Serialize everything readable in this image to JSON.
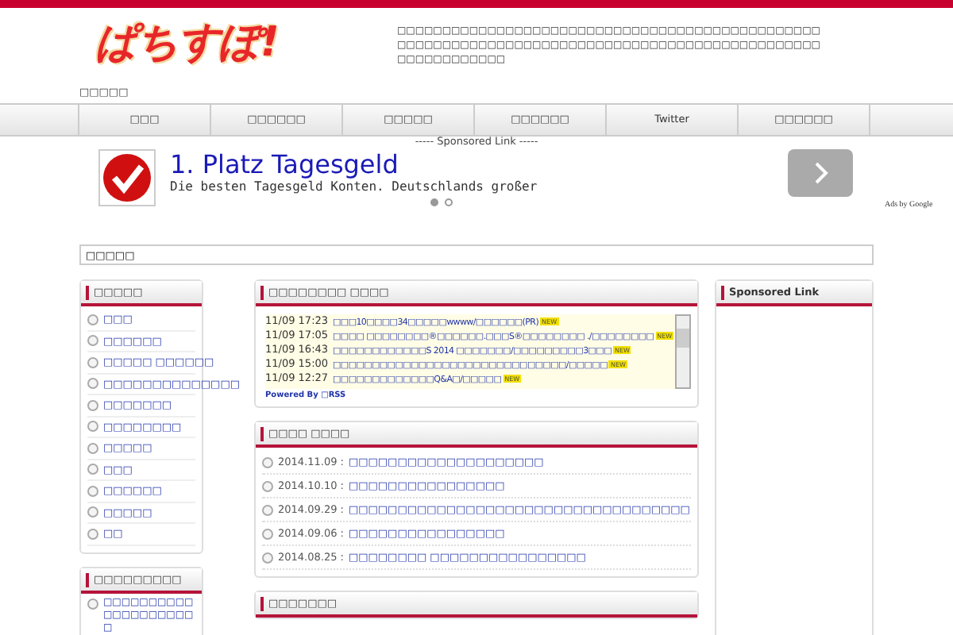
{
  "header": {
    "logo": "ぱちすぽ!",
    "description": "□□□□□□□□□□□□□□□□□□□□□□□□□□□□□□□□□□□□□□□□□□□□□□□□□□□□□□□□□□□□□□□□□□□□□□□□□□□□□□□□□□□□□□□□□□□□□□□□□□□□□□□□□□",
    "breadcrumb": "□□□□□"
  },
  "nav": [
    "□□□",
    "□□□□□□",
    "□□□□□",
    "□□□□□□",
    "Twitter",
    "□□□□□□"
  ],
  "ad": {
    "label": "----- Sponsored Link -----",
    "title": "1. Platz Tagesgeld",
    "text": "Die besten Tagesgeld Konten. Deutschlands großer",
    "pages": [
      {
        "selected": true
      },
      {
        "selected": false
      }
    ],
    "ads_by": "Ads by Google"
  },
  "search": {
    "value": "□□□□□"
  },
  "left": {
    "title": "□□□□□",
    "items": [
      "□□□",
      "□□□□□□",
      "□□□□□ □□□□□□",
      "□□□□□□□□□□□□□□",
      "□□□□□□□",
      "□□□□□□□□",
      "□□□□□",
      "□□□",
      "□□□□□□",
      "□□□□□",
      "□□"
    ]
  },
  "left2": {
    "title": "□□□□□□□□□",
    "items": [
      "□□□□□□□□□□□□□□□□□□□□□"
    ]
  },
  "feed": {
    "title": "□□□□□□□□ □□□□",
    "rows": [
      {
        "time": "11/09 17:23",
        "text": "□□□10□□□□34□□□□□wwww/□□□□□□(PR)",
        "badge": "NEW"
      },
      {
        "time": "11/09 17:05",
        "text": "□□□□ □□□□□□□□®□□□□□□.□□□S®□□□□□□□□ ./□□□□□□□□",
        "badge": "NEW"
      },
      {
        "time": "11/09 16:43",
        "text": "□□□□□□□□□□□□S 2014 □□□□□□□/□□□□□□□□□3□□□",
        "badge": "NEW"
      },
      {
        "time": "11/09 15:00",
        "text": "□□□□□□□□□□□□□□□□□□□□□□□□□□□□□□/□□□□□",
        "badge": "NEW"
      },
      {
        "time": "11/09 12:27",
        "text": "□□□□□□□□□□□□□Q&A□/□□□□□",
        "badge": "NEW"
      }
    ],
    "powered": "Powered By □RSS"
  },
  "news": {
    "title": "□□□□ □□□□",
    "rows": [
      {
        "date": "2014.11.09 :",
        "text": "□□□□□□□□□□□□□□□□□□□□"
      },
      {
        "date": "2014.10.10 :",
        "text": "□□□□□□□□□□□□□□□□"
      },
      {
        "date": "2014.09.29 :",
        "text": "□□□□□□□□□□□□□□□□□□□□□□□□□□□□□□□□□□□"
      },
      {
        "date": "2014.09.06 :",
        "text": "□□□□□□□□□□□□□□□□"
      },
      {
        "date": "2014.08.25 :",
        "text": "□□□□□□□□ □□□□□□□□□□□□□□□□"
      }
    ]
  },
  "middle3": {
    "title": "□□□□□□□"
  },
  "right": {
    "title": "Sponsored Link"
  }
}
